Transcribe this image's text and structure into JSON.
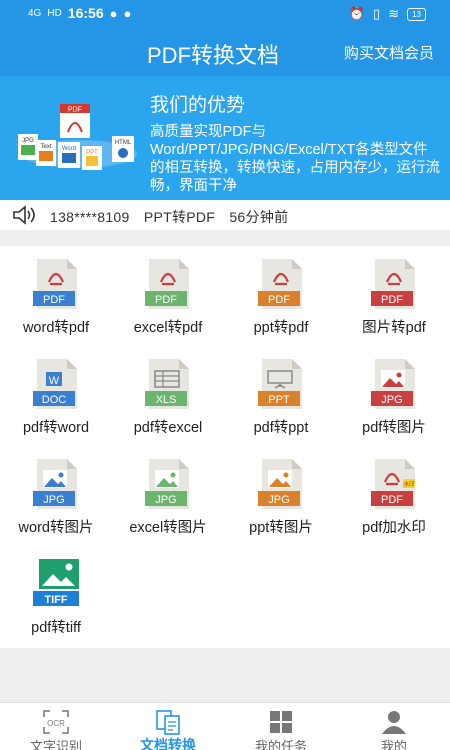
{
  "status_bar": {
    "network": "4G",
    "hd": "HD",
    "time": "16:56",
    "battery": "13"
  },
  "header": {
    "title": "PDF转换文档",
    "member": "购买文档会员"
  },
  "banner": {
    "title": "我们的优势",
    "description": "高质量实现PDF与Word/PPT/JPG/PNG/Excel/TXT各类型文件的相互转换，转换快速，占用内存少，运行流畅，界面干净",
    "art_labels": {
      "pdf": "PDF",
      "jpg": "JPG",
      "text": "Text",
      "word": "Word",
      "ppt": "PPT",
      "html": "HTML"
    }
  },
  "notice": {
    "phone": "138****8109",
    "action": "PPT转PDF",
    "time": "56分钟前"
  },
  "tools": [
    {
      "label": "word转pdf",
      "badge": "PDF",
      "color": "#3b7fd0",
      "icon": "word-to-pdf-icon"
    },
    {
      "label": "excel转pdf",
      "badge": "PDF",
      "color": "#6bb56e",
      "icon": "excel-to-pdf-icon"
    },
    {
      "label": "ppt转pdf",
      "badge": "PDF",
      "color": "#d9822b",
      "icon": "ppt-to-pdf-icon"
    },
    {
      "label": "图片转pdf",
      "badge": "PDF",
      "color": "#c94040",
      "icon": "image-to-pdf-icon"
    },
    {
      "label": "pdf转word",
      "badge": "DOC",
      "color": "#3b7fd0",
      "icon": "pdf-to-word-icon"
    },
    {
      "label": "pdf转excel",
      "badge": "XLS",
      "color": "#6bb56e",
      "icon": "pdf-to-excel-icon"
    },
    {
      "label": "pdf转ppt",
      "badge": "PPT",
      "color": "#d9822b",
      "icon": "pdf-to-ppt-icon"
    },
    {
      "label": "pdf转图片",
      "badge": "JPG",
      "color": "#c94040",
      "icon": "pdf-to-image-icon"
    },
    {
      "label": "word转图片",
      "badge": "JPG",
      "color": "#3b7fd0",
      "icon": "word-to-image-icon"
    },
    {
      "label": "excel转图片",
      "badge": "JPG",
      "color": "#6bb56e",
      "icon": "excel-to-image-icon"
    },
    {
      "label": "ppt转图片",
      "badge": "JPG",
      "color": "#d9822b",
      "icon": "ppt-to-image-icon"
    },
    {
      "label": "pdf加水印",
      "badge": "PDF",
      "color": "#c94040",
      "icon": "pdf-watermark-icon"
    },
    {
      "label": "pdf转tiff",
      "badge": "TIFF",
      "color": "#1d7fd6",
      "icon": "pdf-to-tiff-icon"
    }
  ],
  "watermark_tag": "水印",
  "tabs": [
    {
      "label": "文字识别",
      "icon": "ocr-icon",
      "icon_text": "OCR",
      "active": false
    },
    {
      "label": "文档转换",
      "icon": "document-convert-icon",
      "active": true
    },
    {
      "label": "我的任务",
      "icon": "task-grid-icon",
      "active": false
    },
    {
      "label": "我的",
      "icon": "user-icon",
      "active": false
    }
  ],
  "colors": {
    "primary": "#2596e6",
    "banner": "#2ba5ee",
    "tab_active": "#2596e6"
  }
}
